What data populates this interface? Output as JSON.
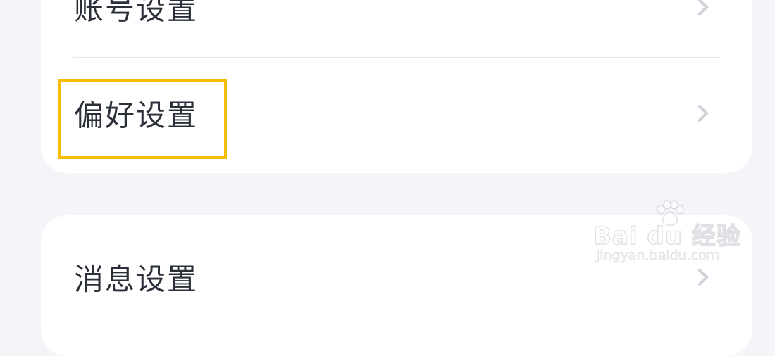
{
  "settings": {
    "group1": {
      "account_label": "账号设置",
      "preference_label": "偏好设置"
    },
    "group2": {
      "message_label": "消息设置"
    }
  },
  "watermark": {
    "brand": "Bai du 经验",
    "site": "jingyan.baidu.com"
  },
  "colors": {
    "background": "#f4f5f9",
    "card": "#ffffff",
    "text": "#2a2f3a",
    "chevron": "#cfd2d8",
    "highlight": "#f5bd00"
  },
  "icons": {
    "chevron": "chevron-right-icon",
    "watermark_logo": "baidu-paw-icon"
  }
}
